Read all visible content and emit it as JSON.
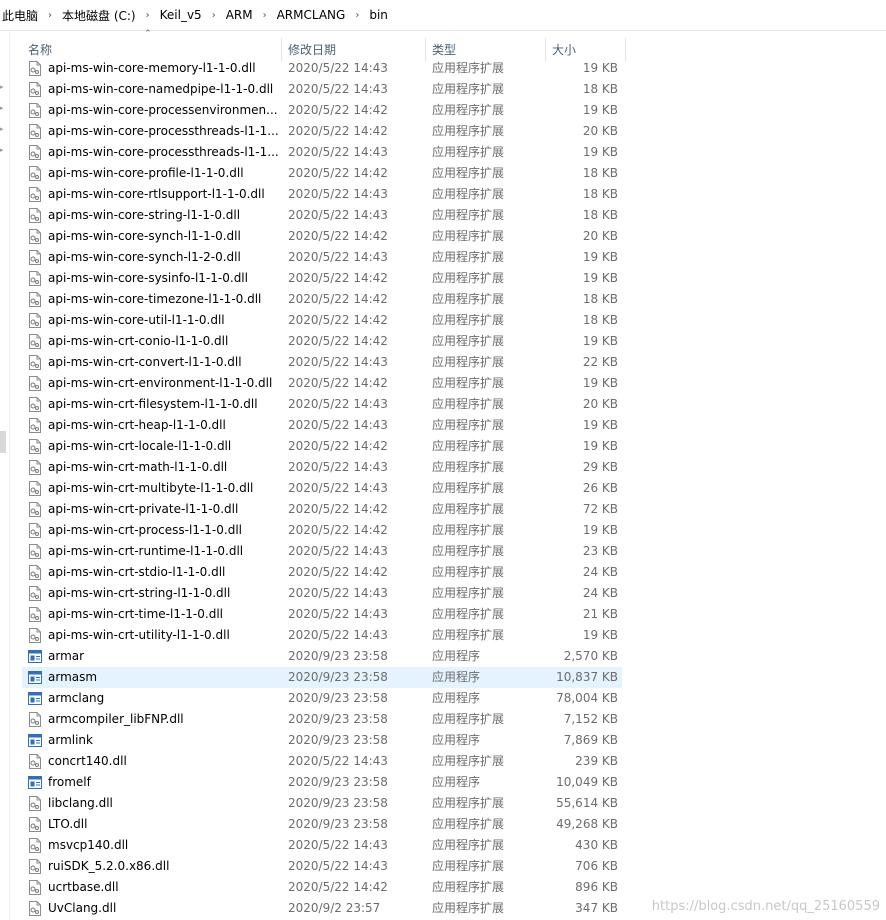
{
  "breadcrumb": [
    "此电脑",
    "本地磁盘 (C:)",
    "Keil_v5",
    "ARM",
    "ARMCLANG",
    "bin"
  ],
  "columns": {
    "name": "名称",
    "date": "修改日期",
    "type": "类型",
    "size": "大小"
  },
  "colors": {
    "selected_row": "#e5f3ff",
    "header_text": "#4c607a",
    "accent": "#2e6fbf"
  },
  "files": [
    {
      "name": "api-ms-win-core-memory-l1-1-0.dll",
      "date": "2020/5/22 14:43",
      "type": "应用程序扩展",
      "size": "19 KB",
      "icon": "dll-file-icon"
    },
    {
      "name": "api-ms-win-core-namedpipe-l1-1-0.dll",
      "date": "2020/5/22 14:43",
      "type": "应用程序扩展",
      "size": "18 KB",
      "icon": "dll-file-icon"
    },
    {
      "name": "api-ms-win-core-processenvironmen...",
      "date": "2020/5/22 14:42",
      "type": "应用程序扩展",
      "size": "19 KB",
      "icon": "dll-file-icon"
    },
    {
      "name": "api-ms-win-core-processthreads-l1-1...",
      "date": "2020/5/22 14:42",
      "type": "应用程序扩展",
      "size": "20 KB",
      "icon": "dll-file-icon"
    },
    {
      "name": "api-ms-win-core-processthreads-l1-1...",
      "date": "2020/5/22 14:43",
      "type": "应用程序扩展",
      "size": "19 KB",
      "icon": "dll-file-icon"
    },
    {
      "name": "api-ms-win-core-profile-l1-1-0.dll",
      "date": "2020/5/22 14:42",
      "type": "应用程序扩展",
      "size": "18 KB",
      "icon": "dll-file-icon"
    },
    {
      "name": "api-ms-win-core-rtlsupport-l1-1-0.dll",
      "date": "2020/5/22 14:43",
      "type": "应用程序扩展",
      "size": "18 KB",
      "icon": "dll-file-icon"
    },
    {
      "name": "api-ms-win-core-string-l1-1-0.dll",
      "date": "2020/5/22 14:43",
      "type": "应用程序扩展",
      "size": "18 KB",
      "icon": "dll-file-icon"
    },
    {
      "name": "api-ms-win-core-synch-l1-1-0.dll",
      "date": "2020/5/22 14:42",
      "type": "应用程序扩展",
      "size": "20 KB",
      "icon": "dll-file-icon"
    },
    {
      "name": "api-ms-win-core-synch-l1-2-0.dll",
      "date": "2020/5/22 14:43",
      "type": "应用程序扩展",
      "size": "19 KB",
      "icon": "dll-file-icon"
    },
    {
      "name": "api-ms-win-core-sysinfo-l1-1-0.dll",
      "date": "2020/5/22 14:42",
      "type": "应用程序扩展",
      "size": "19 KB",
      "icon": "dll-file-icon"
    },
    {
      "name": "api-ms-win-core-timezone-l1-1-0.dll",
      "date": "2020/5/22 14:42",
      "type": "应用程序扩展",
      "size": "18 KB",
      "icon": "dll-file-icon"
    },
    {
      "name": "api-ms-win-core-util-l1-1-0.dll",
      "date": "2020/5/22 14:42",
      "type": "应用程序扩展",
      "size": "18 KB",
      "icon": "dll-file-icon"
    },
    {
      "name": "api-ms-win-crt-conio-l1-1-0.dll",
      "date": "2020/5/22 14:42",
      "type": "应用程序扩展",
      "size": "19 KB",
      "icon": "dll-file-icon"
    },
    {
      "name": "api-ms-win-crt-convert-l1-1-0.dll",
      "date": "2020/5/22 14:43",
      "type": "应用程序扩展",
      "size": "22 KB",
      "icon": "dll-file-icon"
    },
    {
      "name": "api-ms-win-crt-environment-l1-1-0.dll",
      "date": "2020/5/22 14:42",
      "type": "应用程序扩展",
      "size": "19 KB",
      "icon": "dll-file-icon"
    },
    {
      "name": "api-ms-win-crt-filesystem-l1-1-0.dll",
      "date": "2020/5/22 14:43",
      "type": "应用程序扩展",
      "size": "20 KB",
      "icon": "dll-file-icon"
    },
    {
      "name": "api-ms-win-crt-heap-l1-1-0.dll",
      "date": "2020/5/22 14:43",
      "type": "应用程序扩展",
      "size": "19 KB",
      "icon": "dll-file-icon"
    },
    {
      "name": "api-ms-win-crt-locale-l1-1-0.dll",
      "date": "2020/5/22 14:42",
      "type": "应用程序扩展",
      "size": "19 KB",
      "icon": "dll-file-icon"
    },
    {
      "name": "api-ms-win-crt-math-l1-1-0.dll",
      "date": "2020/5/22 14:43",
      "type": "应用程序扩展",
      "size": "29 KB",
      "icon": "dll-file-icon"
    },
    {
      "name": "api-ms-win-crt-multibyte-l1-1-0.dll",
      "date": "2020/5/22 14:43",
      "type": "应用程序扩展",
      "size": "26 KB",
      "icon": "dll-file-icon"
    },
    {
      "name": "api-ms-win-crt-private-l1-1-0.dll",
      "date": "2020/5/22 14:42",
      "type": "应用程序扩展",
      "size": "72 KB",
      "icon": "dll-file-icon"
    },
    {
      "name": "api-ms-win-crt-process-l1-1-0.dll",
      "date": "2020/5/22 14:42",
      "type": "应用程序扩展",
      "size": "19 KB",
      "icon": "dll-file-icon"
    },
    {
      "name": "api-ms-win-crt-runtime-l1-1-0.dll",
      "date": "2020/5/22 14:43",
      "type": "应用程序扩展",
      "size": "23 KB",
      "icon": "dll-file-icon"
    },
    {
      "name": "api-ms-win-crt-stdio-l1-1-0.dll",
      "date": "2020/5/22 14:42",
      "type": "应用程序扩展",
      "size": "24 KB",
      "icon": "dll-file-icon"
    },
    {
      "name": "api-ms-win-crt-string-l1-1-0.dll",
      "date": "2020/5/22 14:43",
      "type": "应用程序扩展",
      "size": "24 KB",
      "icon": "dll-file-icon"
    },
    {
      "name": "api-ms-win-crt-time-l1-1-0.dll",
      "date": "2020/5/22 14:43",
      "type": "应用程序扩展",
      "size": "21 KB",
      "icon": "dll-file-icon"
    },
    {
      "name": "api-ms-win-crt-utility-l1-1-0.dll",
      "date": "2020/5/22 14:43",
      "type": "应用程序扩展",
      "size": "19 KB",
      "icon": "dll-file-icon"
    },
    {
      "name": "armar",
      "date": "2020/9/23 23:58",
      "type": "应用程序",
      "size": "2,570 KB",
      "icon": "exe-app-icon"
    },
    {
      "name": "armasm",
      "date": "2020/9/23 23:58",
      "type": "应用程序",
      "size": "10,837 KB",
      "icon": "exe-app-icon",
      "selected": true
    },
    {
      "name": "armclang",
      "date": "2020/9/23 23:58",
      "type": "应用程序",
      "size": "78,004 KB",
      "icon": "exe-app-icon"
    },
    {
      "name": "armcompiler_libFNP.dll",
      "date": "2020/9/23 23:58",
      "type": "应用程序扩展",
      "size": "7,152 KB",
      "icon": "dll-file-icon"
    },
    {
      "name": "armlink",
      "date": "2020/9/23 23:58",
      "type": "应用程序",
      "size": "7,869 KB",
      "icon": "exe-app-icon"
    },
    {
      "name": "concrt140.dll",
      "date": "2020/5/22 14:43",
      "type": "应用程序扩展",
      "size": "239 KB",
      "icon": "dll-file-icon"
    },
    {
      "name": "fromelf",
      "date": "2020/9/23 23:58",
      "type": "应用程序",
      "size": "10,049 KB",
      "icon": "exe-app-icon"
    },
    {
      "name": "libclang.dll",
      "date": "2020/9/23 23:58",
      "type": "应用程序扩展",
      "size": "55,614 KB",
      "icon": "dll-file-icon"
    },
    {
      "name": "LTO.dll",
      "date": "2020/9/23 23:58",
      "type": "应用程序扩展",
      "size": "49,268 KB",
      "icon": "dll-file-icon"
    },
    {
      "name": "msvcp140.dll",
      "date": "2020/5/22 14:43",
      "type": "应用程序扩展",
      "size": "430 KB",
      "icon": "dll-file-icon"
    },
    {
      "name": "ruiSDK_5.2.0.x86.dll",
      "date": "2020/5/22 14:43",
      "type": "应用程序扩展",
      "size": "706 KB",
      "icon": "dll-file-icon"
    },
    {
      "name": "ucrtbase.dll",
      "date": "2020/5/22 14:42",
      "type": "应用程序扩展",
      "size": "896 KB",
      "icon": "dll-file-icon"
    },
    {
      "name": "UvClang.dll",
      "date": "2020/9/2 23:57",
      "type": "应用程序扩展",
      "size": "347 KB",
      "icon": "dll-file-icon"
    }
  ],
  "watermark": "https://blog.csdn.net/qq_25160559"
}
